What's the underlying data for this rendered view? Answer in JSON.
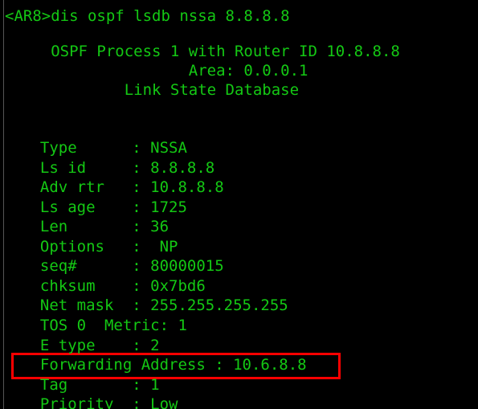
{
  "terminal": {
    "background_color": "#000000",
    "text_color": "#14c814",
    "highlight_color": "#ff0000",
    "scrollback_remnant": "                            f"
  },
  "prompt": {
    "full_line": "<AR8>dis ospf lsdb nssa 8.8.8.8",
    "hostname": "<AR8>",
    "command": "dis ospf lsdb nssa 8.8.8.8"
  },
  "header": {
    "process_line": "     OSPF Process 1 with Router ID 10.8.8.8",
    "area_line": "                    Area: 0.0.0.1",
    "title_line": "             Link State Database",
    "process_id": "1",
    "router_id": "10.8.8.8",
    "area": "0.0.0.1",
    "database_title": "Link State Database"
  },
  "lsa": {
    "rows": [
      {
        "text": "  Type      : NSSA",
        "label": "Type",
        "value": "NSSA"
      },
      {
        "text": "  Ls id     : 8.8.8.8",
        "label": "Ls id",
        "value": "8.8.8.8"
      },
      {
        "text": "  Adv rtr   : 10.8.8.8",
        "label": "Adv rtr",
        "value": "10.8.8.8"
      },
      {
        "text": "  Ls age    : 1725",
        "label": "Ls age",
        "value": "1725"
      },
      {
        "text": "  Len       : 36",
        "label": "Len",
        "value": "36"
      },
      {
        "text": "  Options   :  NP",
        "label": "Options",
        "value": "NP"
      },
      {
        "text": "  seq#      : 80000015",
        "label": "seq#",
        "value": "80000015"
      },
      {
        "text": "  chksum    : 0x7bd6",
        "label": "chksum",
        "value": "0x7bd6"
      },
      {
        "text": "  Net mask  : 255.255.255.255",
        "label": "Net mask",
        "value": "255.255.255.255"
      },
      {
        "text": "  TOS 0  Metric: 1",
        "label": "TOS 0  Metric",
        "value": "1"
      },
      {
        "text": "  E type    : 2",
        "label": "E type",
        "value": "2"
      },
      {
        "text": "  Forwarding Address : 10.6.8.8",
        "label": "Forwarding Address",
        "value": "10.6.8.8"
      },
      {
        "text": "  Tag       : 1",
        "label": "Tag",
        "value": "1"
      },
      {
        "text": "  Priority  : Low",
        "label": "Priority",
        "value": "Low"
      }
    ],
    "highlighted_row_index": 11
  }
}
